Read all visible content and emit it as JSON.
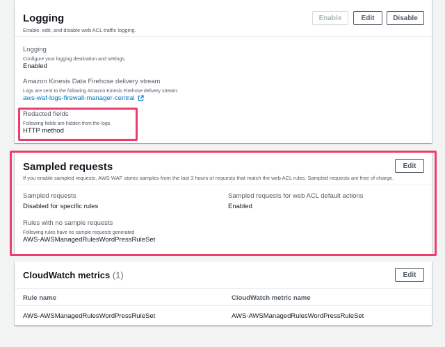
{
  "logging": {
    "title": "Logging",
    "description": "Enable, edit, and disable web ACL traffic logging.",
    "buttons": {
      "enable": "Enable",
      "edit": "Edit",
      "disable": "Disable"
    },
    "fields": {
      "logging": {
        "label": "Logging",
        "description": "Configure your logging destination and settings.",
        "value": "Enabled"
      },
      "firehose": {
        "label": "Amazon Kinesis Data Firehose delivery stream",
        "description": "Logs are sent to the following Amazon Kinesis Firehose delivery stream:",
        "link": "aws-waf-logs-firewall-manager-central"
      },
      "redacted": {
        "label": "Redacted fields",
        "description": "Following fields are hidden from the logs.",
        "value": "HTTP method"
      }
    }
  },
  "sampled": {
    "title": "Sampled requests",
    "description": "If you enable sampled requests, AWS WAF stores samples from the last 3 hours of requests that match the web ACL rules. Sampled requests are free of charge.",
    "edit": "Edit",
    "fields": {
      "sampled_requests": {
        "label": "Sampled requests",
        "value": "Disabled for specific rules"
      },
      "default_actions": {
        "label": "Sampled requests for web ACL default actions",
        "value": "Enabled"
      },
      "no_sample": {
        "label": "Rules with no sample requests",
        "description": "Following rules have no sample requests generated",
        "value": "AWS-AWSManagedRulesWordPressRuleSet"
      }
    }
  },
  "cloudwatch": {
    "title": "CloudWatch metrics",
    "count": "(1)",
    "edit": "Edit",
    "columns": [
      "Rule name",
      "CloudWatch metric name"
    ],
    "rows": [
      [
        "AWS-AWSManagedRulesWordPressRuleSet",
        "AWS-AWSManagedRulesWordPressRuleSet"
      ]
    ]
  },
  "colors": {
    "highlight": "#ec3d6c",
    "link": "#0073bb"
  },
  "icons": {
    "external_link": "external-link-icon"
  }
}
